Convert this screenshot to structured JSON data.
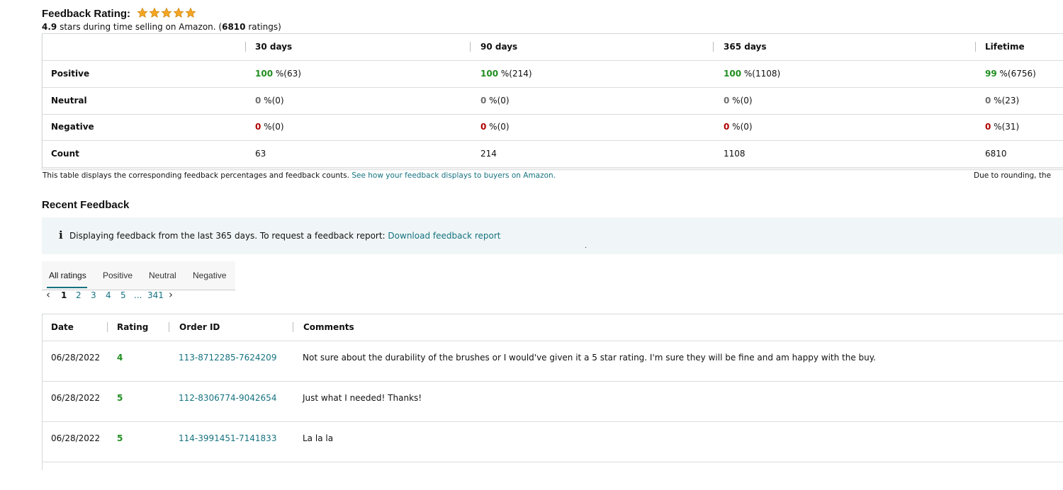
{
  "feedback_rating": {
    "title": "Feedback Rating:",
    "stars": 5,
    "star_color": "#f5a623",
    "summary_stars_value": "4.9",
    "summary_mid": " stars during time selling on Amazon. (",
    "summary_count": "6810",
    "summary_end": " ratings)"
  },
  "summary_table": {
    "headers": [
      "30 days",
      "90 days",
      "365 days",
      "Lifetime"
    ],
    "rows": [
      {
        "label": "Positive",
        "cells": [
          {
            "v": "100",
            "s": " %(63)"
          },
          {
            "v": "100",
            "s": " %(214)"
          },
          {
            "v": "100",
            "s": " %(1108)"
          },
          {
            "v": "99",
            "s": " %(6756)"
          }
        ]
      },
      {
        "label": "Neutral",
        "cells": [
          {
            "v": "0",
            "s": " %(0)"
          },
          {
            "v": "0",
            "s": " %(0)"
          },
          {
            "v": "0",
            "s": " %(0)"
          },
          {
            "v": "0",
            "s": " %(23)"
          }
        ]
      },
      {
        "label": "Negative",
        "cells": [
          {
            "v": "0",
            "s": " %(0)"
          },
          {
            "v": "0",
            "s": " %(0)"
          },
          {
            "v": "0",
            "s": " %(0)"
          },
          {
            "v": "0",
            "s": " %(31)"
          }
        ]
      },
      {
        "label": "Count",
        "cells": [
          {
            "v": "63"
          },
          {
            "v": "214"
          },
          {
            "v": "1108"
          },
          {
            "v": "6810"
          }
        ]
      }
    ],
    "note_text": "This table displays the corresponding feedback percentages and feedback counts. ",
    "note_link": "See how your feedback displays to buyers on Amazon.",
    "rounding_note": "Due to rounding, the"
  },
  "recent": {
    "title": "Recent Feedback",
    "info_icon": "i",
    "info_text": "Displaying feedback from the last 365 days. To request a feedback report: ",
    "info_link": "Download feedback report",
    "info_dot": ".",
    "tabs": [
      "All ratings",
      "Positive",
      "Neutral",
      "Negative"
    ],
    "pager": {
      "prev": "‹",
      "pages": [
        "1",
        "2",
        "3",
        "4",
        "5"
      ],
      "ellipsis": "...",
      "last": "341",
      "next": "›"
    },
    "headers": [
      "Date",
      "Rating",
      "Order ID",
      "Comments"
    ],
    "rows": [
      {
        "date": "06/28/2022",
        "rating": "4",
        "order": "113-8712285-7624209",
        "comment": "Not sure about the durability of the brushes or I would've given it a 5 star rating. I'm sure they will be fine and am happy with the buy."
      },
      {
        "date": "06/28/2022",
        "rating": "5",
        "order": "112-8306774-9042654",
        "comment": "Just what I needed! Thanks!"
      },
      {
        "date": "06/28/2022",
        "rating": "5",
        "order": "114-3991451-7141833",
        "comment": "La la la"
      }
    ]
  },
  "colors": {
    "link": "#167380",
    "positive": "#1e8e1e",
    "negative": "#b00000",
    "neutral": "#6f6f6f"
  }
}
